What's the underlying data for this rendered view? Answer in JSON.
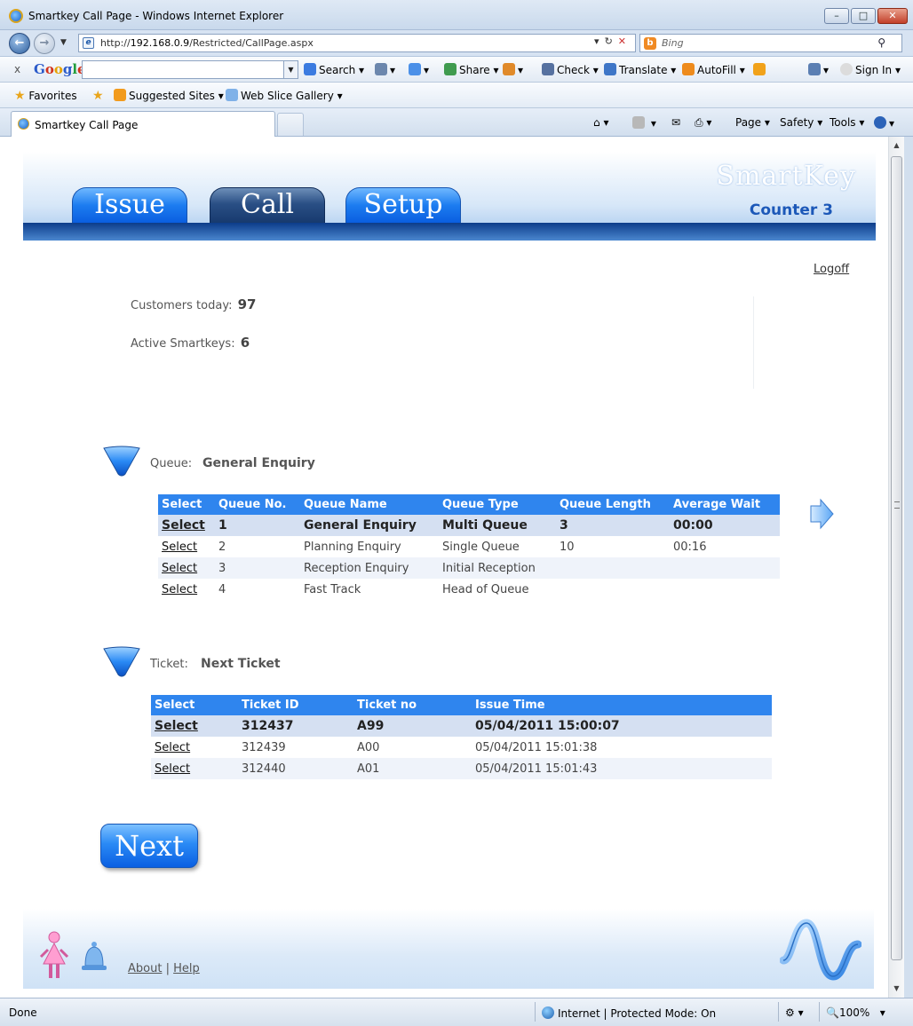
{
  "window": {
    "title": "Smartkey Call Page - Windows Internet Explorer",
    "minimize": "–",
    "maximize": "□",
    "close": "✕"
  },
  "address_bar": {
    "url_prefix": "http://",
    "url_host": "192.168.0.9",
    "url_path": "/Restricted/CallPage.aspx",
    "search_placeholder": "Bing"
  },
  "google_toolbar": {
    "close": "x",
    "logo": [
      "G",
      "o",
      "o",
      "g",
      "l",
      "e"
    ],
    "search": "Search ▾",
    "share": "Share ▾",
    "check": "Check ▾",
    "translate": "Translate ▾",
    "autofill": "AutoFill ▾",
    "sign_in": "Sign In ▾"
  },
  "favorites_bar": {
    "favorites": "Favorites",
    "suggested": "Suggested Sites ▾",
    "web_slice": "Web Slice Gallery ▾"
  },
  "tabs_bar": {
    "active_tab": "Smartkey Call Page",
    "page": "Page ▾",
    "safety": "Safety ▾",
    "tools": "Tools ▾"
  },
  "header": {
    "brand": "SmartKey",
    "counter": "Counter 3",
    "tabs": [
      {
        "label": "Issue",
        "active": false
      },
      {
        "label": "Call",
        "active": true
      },
      {
        "label": "Setup",
        "active": false
      }
    ]
  },
  "logoff": "Logoff",
  "stats": {
    "customers_label": "Customers today:",
    "customers_value": "97",
    "smartkeys_label": "Active Smartkeys:",
    "smartkeys_value": "6"
  },
  "queue_section": {
    "label": "Queue:",
    "value": "General Enquiry",
    "columns": [
      "Select",
      "Queue No.",
      "Queue Name",
      "Queue Type",
      "Queue Length",
      "Average Wait"
    ],
    "rows": [
      {
        "select": "Select",
        "no": "1",
        "name": "General Enquiry",
        "type": "Multi Queue",
        "length": "3",
        "wait": "00:00",
        "selected": true
      },
      {
        "select": "Select",
        "no": "2",
        "name": "Planning Enquiry",
        "type": "Single Queue",
        "length": "10",
        "wait": "00:16",
        "selected": false
      },
      {
        "select": "Select",
        "no": "3",
        "name": "Reception Enquiry",
        "type": "Initial Reception",
        "length": "",
        "wait": "",
        "selected": false
      },
      {
        "select": "Select",
        "no": "4",
        "name": "Fast Track",
        "type": "Head of Queue",
        "length": "",
        "wait": "",
        "selected": false
      }
    ]
  },
  "ticket_section": {
    "label": "Ticket:",
    "value": "Next Ticket",
    "columns": [
      "Select",
      "Ticket ID",
      "Ticket no",
      "Issue Time"
    ],
    "rows": [
      {
        "select": "Select",
        "id": "312437",
        "no": "A99",
        "time": "05/04/2011 15:00:07",
        "selected": true
      },
      {
        "select": "Select",
        "id": "312439",
        "no": "A00",
        "time": "05/04/2011 15:01:38",
        "selected": false
      },
      {
        "select": "Select",
        "id": "312440",
        "no": "A01",
        "time": "05/04/2011 15:01:43",
        "selected": false
      }
    ]
  },
  "next_button": "Next",
  "footer": {
    "about": "About",
    "separator": "|",
    "help": "Help"
  },
  "status_bar": {
    "status": "Done",
    "zone": "Internet | Protected Mode: On",
    "zoom": "100%"
  },
  "colors": {
    "header_blue": "#2f85ee",
    "selected_row": "#d5e0f2",
    "tab_active": "#2a4f85",
    "tab_inactive": "#1c7cf0"
  }
}
